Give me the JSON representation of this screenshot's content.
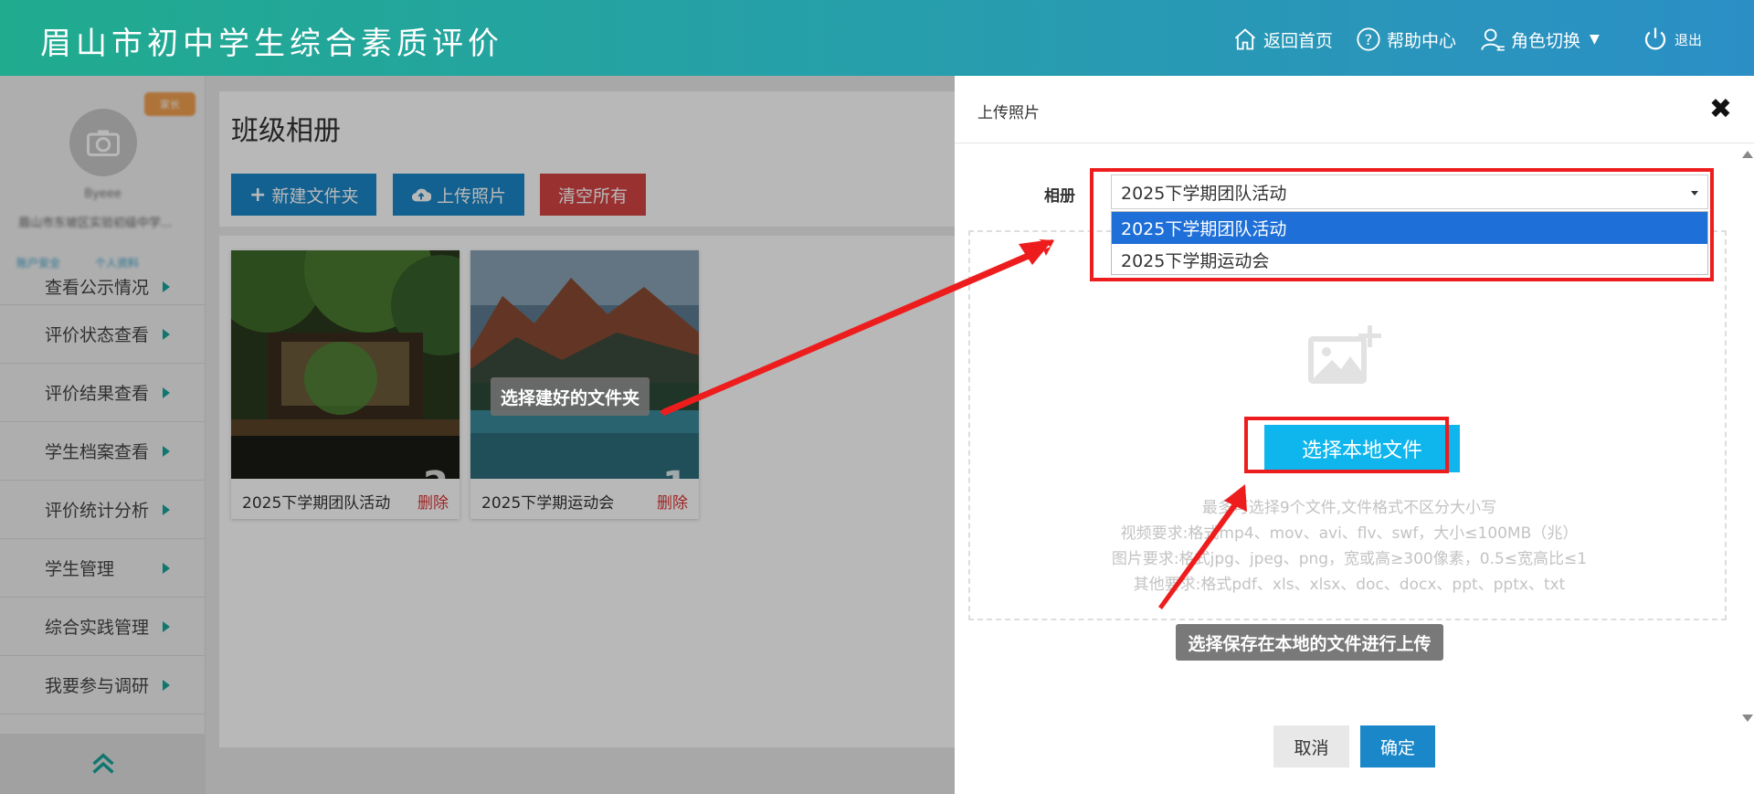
{
  "header": {
    "title": "眉山市初中学生综合素质评价",
    "nav": {
      "home": "返回首页",
      "help": "帮助中心",
      "role": "角色切换",
      "logout": "退出"
    }
  },
  "sidebar": {
    "badge": "家长",
    "user_name": "Byeee",
    "school": "眉山市东坡区实验初级中学...",
    "links": [
      "账户安全",
      "个人资料"
    ],
    "items": [
      {
        "label": "查看公示情况"
      },
      {
        "label": "评价状态查看"
      },
      {
        "label": "评价结果查看"
      },
      {
        "label": "学生档案查看"
      },
      {
        "label": "评价统计分析"
      },
      {
        "label": "学生管理"
      },
      {
        "label": "综合实践管理"
      },
      {
        "label": "我要参与调研"
      }
    ]
  },
  "content": {
    "title": "班级相册",
    "buttons": {
      "new_folder": "新建文件夹",
      "upload": "上传照片",
      "clear": "清空所有"
    },
    "albums": [
      {
        "name": "2025下学期团队活动",
        "count": "2",
        "delete": "删除"
      },
      {
        "name": "2025下学期运动会",
        "count": "1",
        "delete": "删除"
      }
    ]
  },
  "tips": {
    "folder": "选择建好的文件夹",
    "local": "选择保存在本地的文件进行上传"
  },
  "dialog": {
    "title": "上传照片",
    "album_label": "相册",
    "selected": "2025下学期团队活动",
    "options": [
      "2025下学期团队活动",
      "2025下学期运动会"
    ],
    "choose_button": "选择本地文件",
    "requirements": [
      "最多可选择9个文件,文件格式不区分大小写",
      "视频要求:格式mp4、mov、avi、flv、swf，大小≤100MB（兆）",
      "图片要求:格式jpg、jpeg、png，宽或高≥300像素，0.5≤宽高比≤1",
      "其他要求:格式pdf、xls、xlsx、doc、docx、ppt、pptx、txt"
    ],
    "cancel": "取消",
    "confirm": "确定"
  },
  "colors": {
    "accent_blue": "#1a87c9",
    "file_button": "#0fb6ed",
    "highlight_red": "#ee1d1d",
    "danger": "#d64545"
  }
}
